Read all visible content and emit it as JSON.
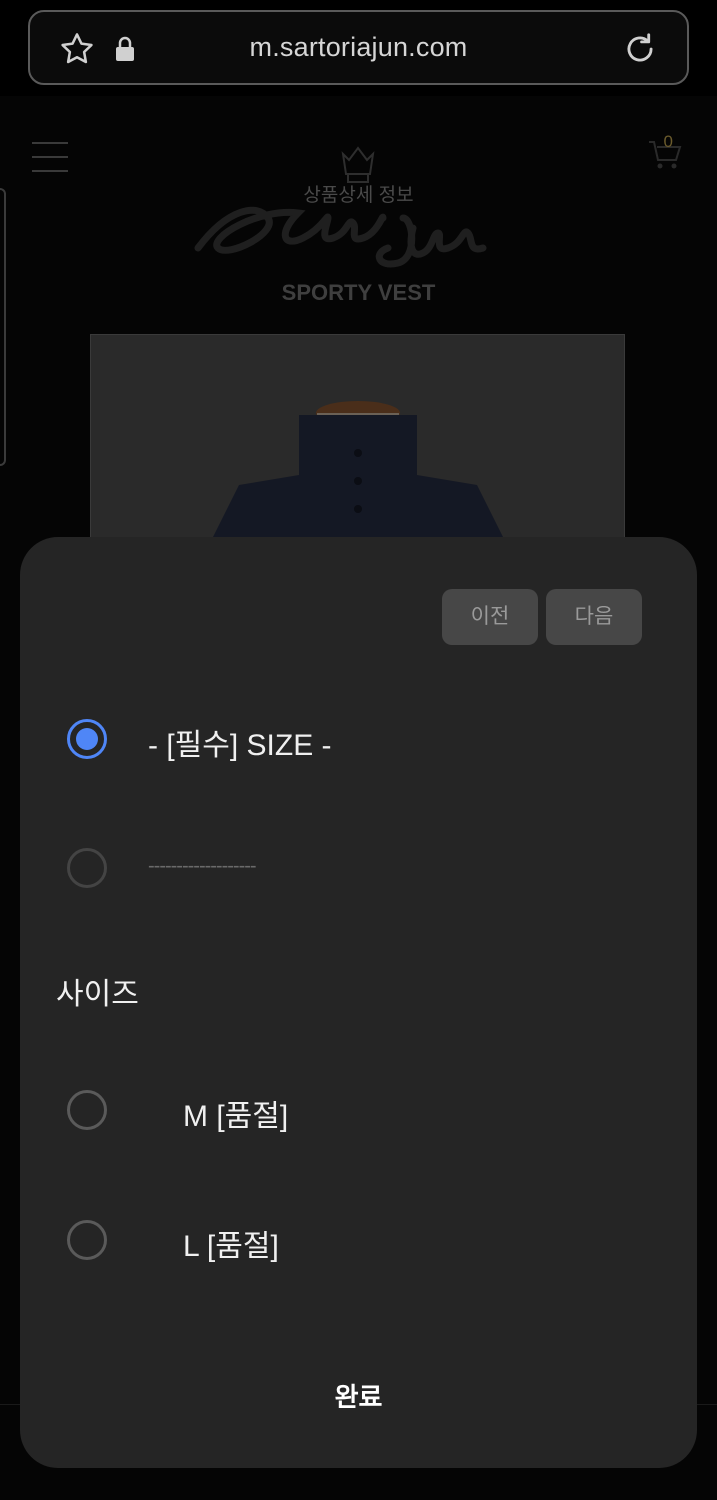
{
  "browser": {
    "url": "m.sartoriajun.com"
  },
  "site": {
    "cart_count": "0",
    "subtitle": "상품상세 정보",
    "product_name": "SPORTY VEST"
  },
  "option_sheet": {
    "prev_label": "이전",
    "next_label": "다음",
    "options": [
      {
        "label": "- [필수] SIZE -",
        "selected": true
      },
      {
        "label": "-------------------",
        "selected": false
      }
    ],
    "group_label": "사이즈",
    "group_options": [
      {
        "label": "M [품절]",
        "selected": false
      },
      {
        "label": "L [품절]",
        "selected": false
      }
    ],
    "done_label": "완료"
  },
  "colors": {
    "accent": "#4f86f7",
    "sheet_bg": "#252525",
    "nav_button_bg": "#474747"
  }
}
